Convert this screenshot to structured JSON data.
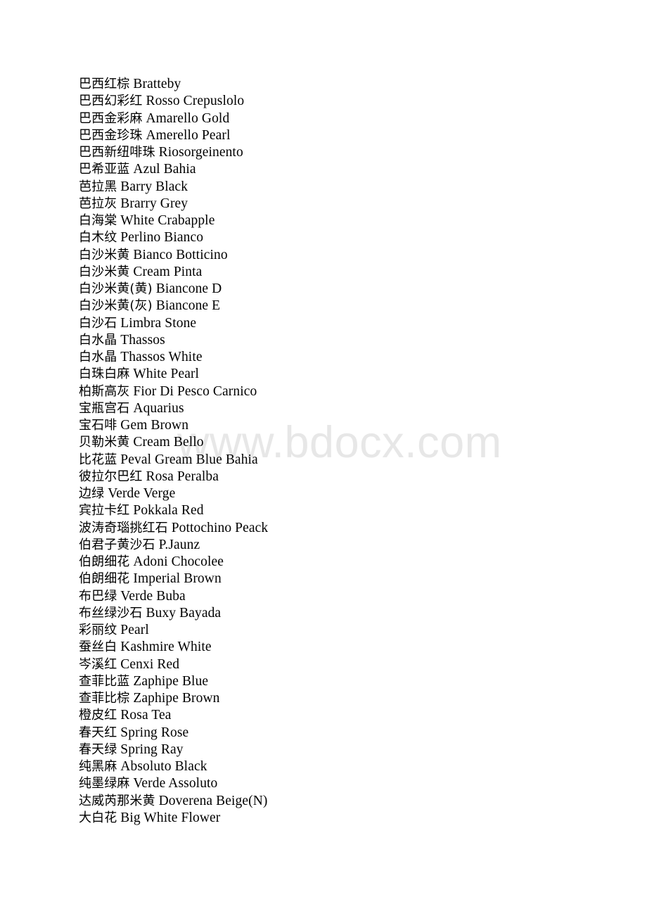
{
  "document": {
    "watermark_text": "www.bdocx.com",
    "watermark_color": "#e7e7e7",
    "text_color": "#000000",
    "background_color": "#ffffff"
  },
  "entries": [
    {
      "cn": "巴西红棕",
      "en": "Bratteby"
    },
    {
      "cn": "巴西幻彩红",
      "en": "Rosso Crepuslolo"
    },
    {
      "cn": "巴西金彩麻",
      "en": "Amarello Gold"
    },
    {
      "cn": "巴西金珍珠",
      "en": "Amerello Pearl"
    },
    {
      "cn": "巴西新纽啡珠",
      "en": "Riosorgeinento"
    },
    {
      "cn": "巴希亚蓝",
      "en": "Azul Bahia"
    },
    {
      "cn": "芭拉黑",
      "en": "Barry Black"
    },
    {
      "cn": "芭拉灰",
      "en": "Brarry Grey"
    },
    {
      "cn": "白海棠",
      "en": "White Crabapple"
    },
    {
      "cn": "白木纹",
      "en": "Perlino Bianco"
    },
    {
      "cn": "白沙米黄",
      "en": "Bianco Botticino"
    },
    {
      "cn": "白沙米黄",
      "en": "Cream Pinta"
    },
    {
      "cn": "白沙米黄(黄)",
      "en": "Biancone D"
    },
    {
      "cn": "白沙米黄(灰)",
      "en": "Biancone E"
    },
    {
      "cn": "白沙石",
      "en": "Limbra Stone"
    },
    {
      "cn": "白水晶",
      "en": "Thassos"
    },
    {
      "cn": "白水晶",
      "en": "Thassos White"
    },
    {
      "cn": "白珠白麻",
      "en": "White Pearl"
    },
    {
      "cn": "柏斯高灰",
      "en": "Fior Di Pesco Carnico"
    },
    {
      "cn": "宝瓶宫石",
      "en": "Aquarius"
    },
    {
      "cn": "宝石啡",
      "en": "Gem Brown"
    },
    {
      "cn": "贝勒米黄",
      "en": "Cream Bello"
    },
    {
      "cn": "比花蓝",
      "en": "Peval Gream Blue Bahia"
    },
    {
      "cn": "彼拉尔巴红",
      "en": "Rosa Peralba"
    },
    {
      "cn": "边绿",
      "en": "Verde Verge"
    },
    {
      "cn": "宾拉卡红",
      "en": "Pokkala Red"
    },
    {
      "cn": "波涛奇瑙挑红石",
      "en": "Pottochino Peack"
    },
    {
      "cn": "伯君子黄沙石",
      "en": "P.Jaunz"
    },
    {
      "cn": "伯朗细花",
      "en": "Adoni Chocolee"
    },
    {
      "cn": "伯朗细花",
      "en": "Imperial Brown"
    },
    {
      "cn": "布巴绿",
      "en": "Verde Buba"
    },
    {
      "cn": "布丝绿沙石",
      "en": "Buxy Bayada"
    },
    {
      "cn": "彩丽纹",
      "en": "Pearl"
    },
    {
      "cn": "蚕丝白",
      "en": "Kashmire White"
    },
    {
      "cn": "岑溪红",
      "en": "Cenxi Red"
    },
    {
      "cn": "查菲比蓝",
      "en": "Zaphipe Blue"
    },
    {
      "cn": "查菲比棕",
      "en": "Zaphipe Brown"
    },
    {
      "cn": "橙皮红",
      "en": "Rosa Tea"
    },
    {
      "cn": "春天红",
      "en": "Spring Rose"
    },
    {
      "cn": "春天绿",
      "en": "Spring Ray"
    },
    {
      "cn": "纯黑麻",
      "en": "Absoluto Black"
    },
    {
      "cn": "纯墨绿麻",
      "en": "Verde Assoluto"
    },
    {
      "cn": "达威芮那米黄",
      "en": "Doverena Beige(N)"
    },
    {
      "cn": "大白花",
      "en": "Big White Flower"
    }
  ]
}
